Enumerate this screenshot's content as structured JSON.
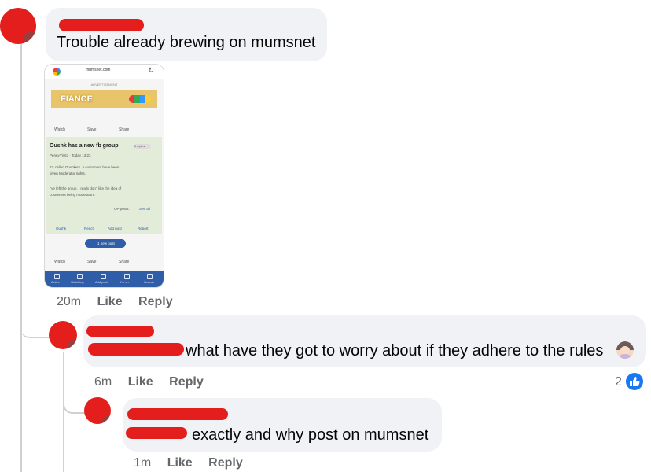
{
  "comment1": {
    "text": "Trouble already brewing on mumsnet",
    "attachment": {
      "url_text": "mumsnet.com",
      "ad_label": "ADVERTISEMENT",
      "ad_text": "FIANCE",
      "watch": "Watch",
      "save": "Save",
      "share": "Share",
      "post_title": "Oushk has a new fb group",
      "replies_badge": "6 replies",
      "author_line": "PennyYin63 · Today 13:22",
      "body1": "It's called Oushkers. 5 customers have been",
      "body2": "given Moderator rights.",
      "body3": "I've left the group. I really don't like the idea of",
      "body4": "customers being moderators.",
      "op_posts": "OP posts:",
      "see_all": "See all",
      "actions": [
        "Oushk",
        "React",
        "Add post",
        "Report"
      ],
      "new_post": "1 new post",
      "bottom_nav": [
        "Active",
        "Watching",
        "Add post",
        "I'm on",
        "Search"
      ]
    },
    "time": "20m",
    "like": "Like",
    "reply": "Reply"
  },
  "comment2": {
    "text": "what have they got to worry about if they adhere to the rules",
    "emoji": "woman-shrugging-emoji",
    "time": "6m",
    "like": "Like",
    "reply": "Reply",
    "reaction_count": "2",
    "reaction_icon": "like-icon"
  },
  "comment3": {
    "text": "exactly and why post on mumsnet",
    "time": "1m",
    "like": "Like",
    "reply": "Reply"
  },
  "colors": {
    "redaction": "#e41d1d",
    "bubble": "#f0f2f5",
    "meta": "#65676b",
    "like_blue": "#1877f2"
  }
}
